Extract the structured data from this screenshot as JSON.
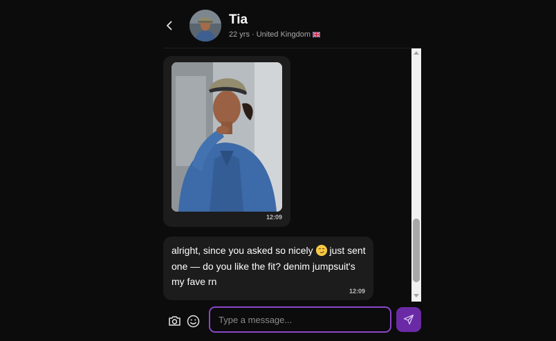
{
  "header": {
    "name": "Tia",
    "meta": "22 yrs · United Kingdom",
    "flag": "🇬🇧"
  },
  "messages": [
    {
      "type": "image",
      "time": "12:09"
    },
    {
      "type": "text",
      "text_before_emoji": "alright, since you asked so nicely ",
      "emoji": "smirk-emoji",
      "text_after_emoji": " just sent one — do you like the fit? denim jumpsuit's my fave rn",
      "time": "12:09"
    }
  ],
  "composer": {
    "placeholder": "Type a message..."
  },
  "colors": {
    "background": "#0c0c0c",
    "bubble": "#1c1c1c",
    "accent_border": "#8b46c9",
    "send_button": "#6a2aa6"
  }
}
